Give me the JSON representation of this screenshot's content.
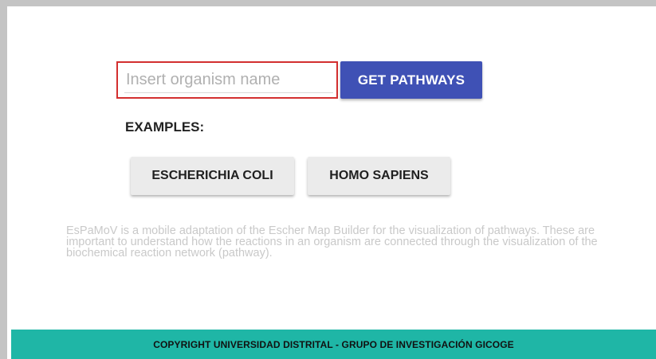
{
  "search": {
    "placeholder": "Insert organism name",
    "value": ""
  },
  "actions": {
    "get_pathways_label": "GET PATHWAYS"
  },
  "examples": {
    "heading": "EXAMPLES:",
    "items": [
      {
        "label": "ESCHERICHIA COLI"
      },
      {
        "label": "HOMO SAPIENS"
      }
    ]
  },
  "description": "EsPaMoV is a mobile adaptation of the Escher Map Builder for the visualization of pathways. These are important to understand how the reactions in an organism are connected through the visualization of the biochemical reaction network (pathway).",
  "footer": {
    "text": "COPYRIGHT UNIVERSIDAD DISTRITAL - GRUPO DE INVESTIGACIÓN GICOGE"
  },
  "colors": {
    "primary": "#3f51b5",
    "footer": "#1fb6a6",
    "focus_border": "#d32f2f"
  }
}
